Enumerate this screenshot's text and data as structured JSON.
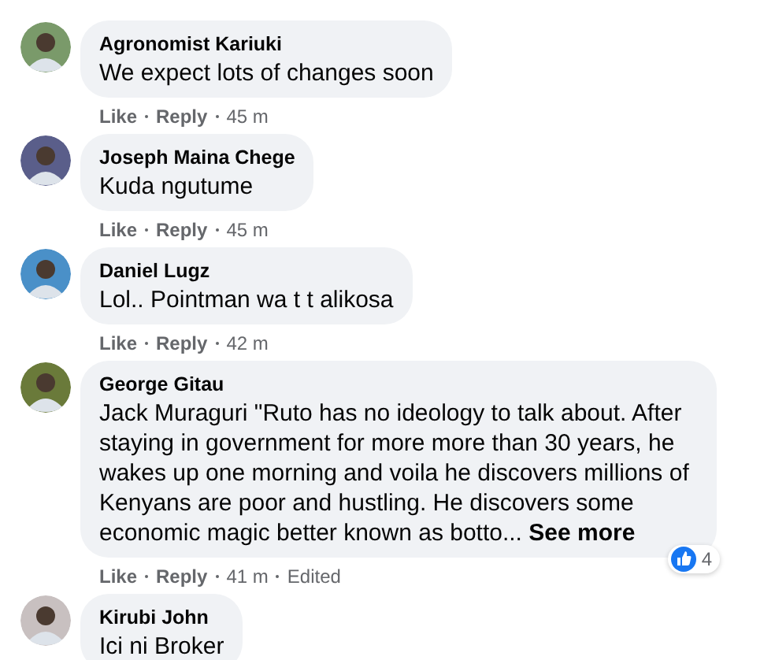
{
  "comments": [
    {
      "author": "Agronomist Kariuki",
      "text": "We expect lots of changes soon",
      "like": "Like",
      "reply": "Reply",
      "time": "45 m"
    },
    {
      "author": "Joseph Maina Chege",
      "text": "Kuda ngutume",
      "like": "Like",
      "reply": "Reply",
      "time": "45 m"
    },
    {
      "author": "Daniel Lugz",
      "text": "Lol.. Pointman wa t t alikosa",
      "like": "Like",
      "reply": "Reply",
      "time": "42 m"
    },
    {
      "author": "George Gitau",
      "text": "Jack Muraguri \"Ruto has no ideology to talk about. After staying in government for more more than 30 years, he wakes up one morning and voila he discovers millions of Kenyans are poor and hustling. He discovers some economic magic better known as botto...",
      "see_more": "See more",
      "like": "Like",
      "reply": "Reply",
      "time": "41 m",
      "edited": "Edited",
      "reaction_count": "4"
    },
    {
      "author": "Kirubi John",
      "text": "Ici ni Broker"
    }
  ]
}
